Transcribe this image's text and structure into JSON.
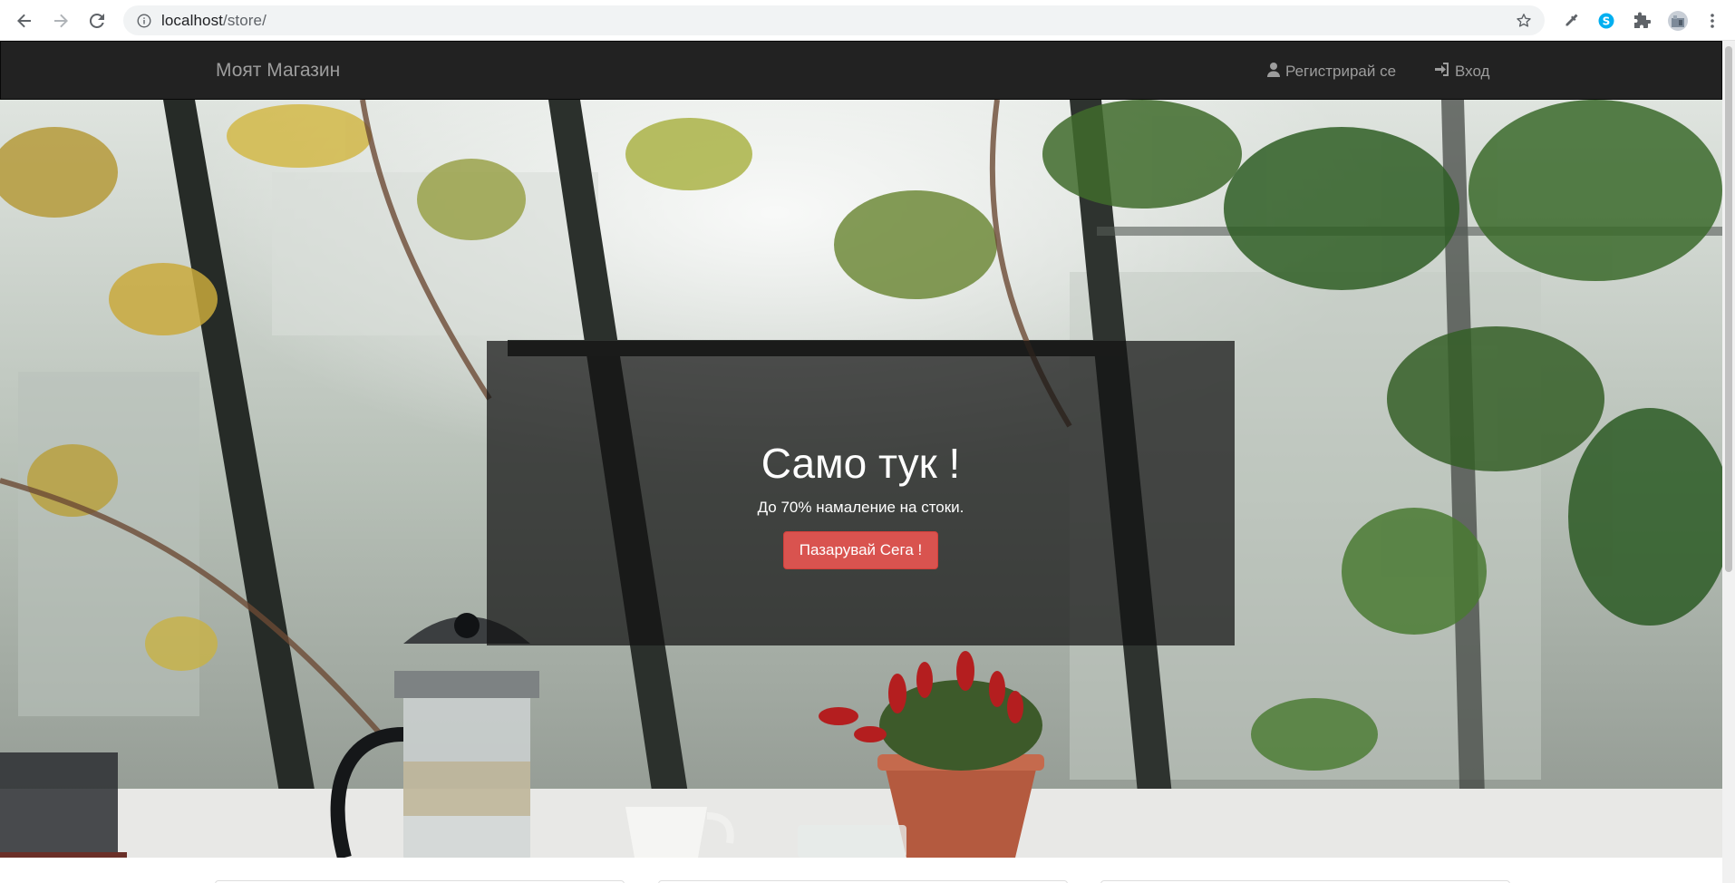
{
  "browser": {
    "url_host": "localhost",
    "url_path": "/store/",
    "icons": [
      "back-icon",
      "forward-icon",
      "reload-icon",
      "info-icon",
      "star-icon",
      "eyedropper-icon",
      "skype-icon",
      "extensions-icon",
      "profile-avatar",
      "more-menu-icon"
    ]
  },
  "navbar": {
    "brand": "Моят Магазин",
    "register_label": "Регистрирай се",
    "login_label": "Вход"
  },
  "hero": {
    "title": "Само тук !",
    "subtitle": "До 70% намаление на стоки.",
    "button_label": "Пазарувай Сега !"
  },
  "colors": {
    "navbar_bg": "#222222",
    "nav_text": "#9d9d9d",
    "button_danger": "#d9534f"
  }
}
